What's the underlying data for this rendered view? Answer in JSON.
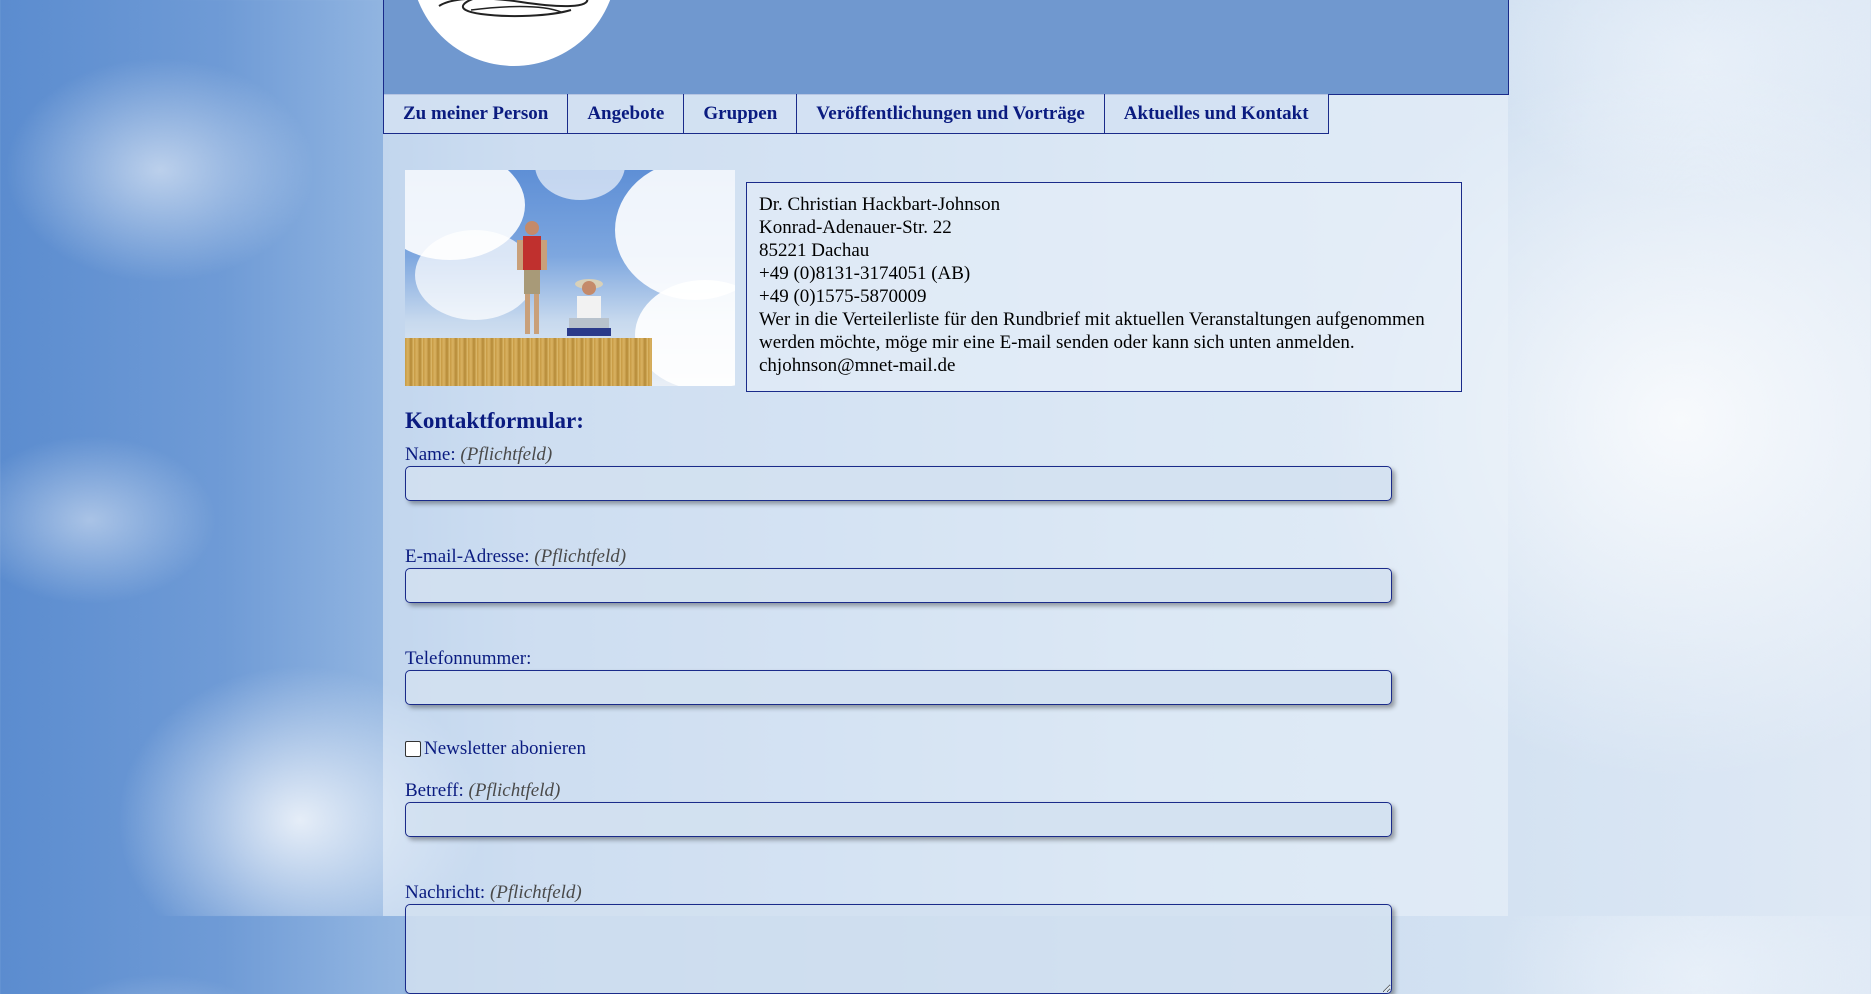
{
  "nav": [
    {
      "label": "Zu meiner Person"
    },
    {
      "label": "Angebote"
    },
    {
      "label": "Gruppen"
    },
    {
      "label": "Veröffentlichungen und Vorträge"
    },
    {
      "label": "Aktuelles und Kontakt"
    }
  ],
  "contact": {
    "name": "Dr. Christian Hackbart-Johnson",
    "street": "Konrad-Adenauer-Str. 22",
    "city": "85221 Dachau",
    "phone1": "+49 (0)8131-3174051 (AB)",
    "phone2": "+49 (0)1575-5870009",
    "note": "Wer in die Verteilerliste für den Rundbrief mit aktuellen Veranstaltungen aufgenommen werden möchte, möge mir eine E-mail senden oder kann sich unten anmelden.",
    "email": "chjohnson@mnet-mail.de"
  },
  "form": {
    "title": "Kontaktformular:",
    "required": "(Pflichtfeld)",
    "name_label": "Name:",
    "email_label": "E-mail-Adresse:",
    "phone_label": "Telefonnummer:",
    "newsletter_label": "Newsletter abonieren",
    "subject_label": "Betreff:",
    "message_label": "Nachricht:"
  },
  "colors": {
    "link": "#0a1b80",
    "header": "#7098cf",
    "border": "#1a2b8a"
  }
}
